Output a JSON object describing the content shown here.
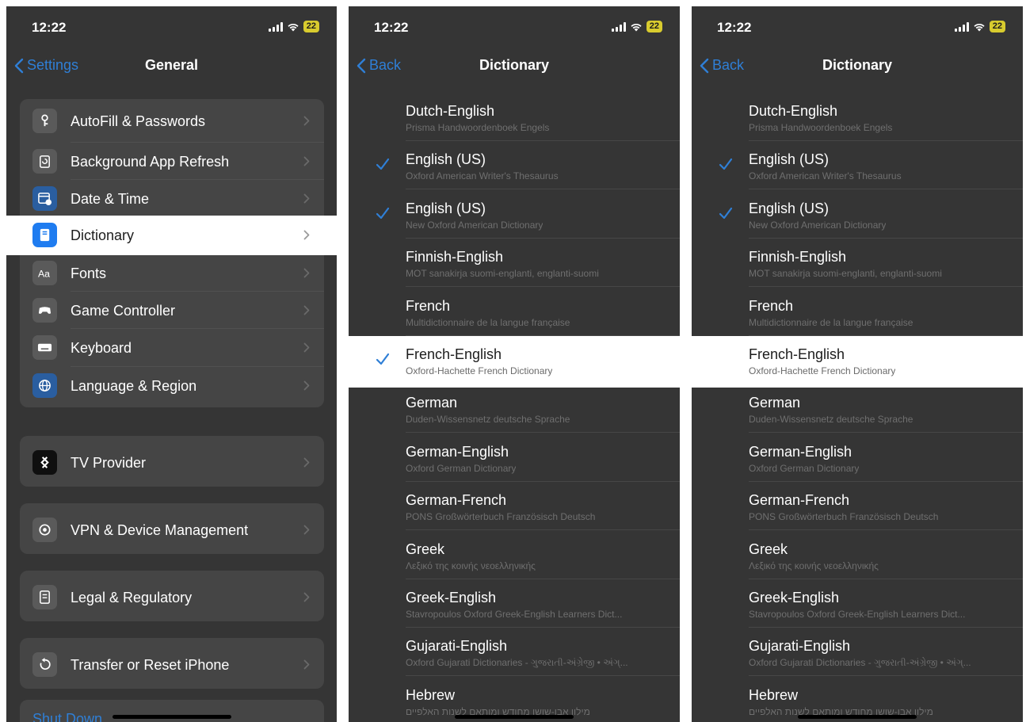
{
  "status": {
    "time": "12:22",
    "battery": "22"
  },
  "panel1": {
    "back_label": "Settings",
    "title": "General",
    "groups": [
      [
        {
          "label": "AutoFill & Passwords",
          "icon": "key-icon"
        },
        {
          "label": "Background App Refresh",
          "icon": "refresh-icon"
        },
        {
          "label": "Date & Time",
          "icon": "calendar-clock-icon"
        },
        {
          "label": "Dictionary",
          "icon": "book-icon"
        },
        {
          "label": "Fonts",
          "icon": "fonts-icon"
        },
        {
          "label": "Game Controller",
          "icon": "gamepad-icon"
        },
        {
          "label": "Keyboard",
          "icon": "keyboard-icon"
        },
        {
          "label": "Language & Region",
          "icon": "globe-icon"
        }
      ],
      [
        {
          "label": "TV Provider",
          "icon": "tv-provider-icon"
        }
      ],
      [
        {
          "label": "VPN & Device Management",
          "icon": "gear-icon"
        }
      ],
      [
        {
          "label": "Legal & Regulatory",
          "icon": "document-icon"
        }
      ],
      [
        {
          "label": "Transfer or Reset iPhone",
          "icon": "reset-icon"
        }
      ]
    ],
    "shutdown_label": "Shut Down"
  },
  "panel2": {
    "back_label": "Back",
    "title": "Dictionary"
  },
  "panel3": {
    "back_label": "Back",
    "title": "Dictionary"
  },
  "dictionaries": [
    {
      "name": "Dutch-English",
      "source": "Prisma Handwoordenboek Engels"
    },
    {
      "name": "English (US)",
      "source": "Oxford American Writer's Thesaurus"
    },
    {
      "name": "English (US)",
      "source": "New Oxford American Dictionary"
    },
    {
      "name": "Finnish-English",
      "source": "MOT sanakirja suomi-englanti, englanti-suomi"
    },
    {
      "name": "French",
      "source": "Multidictionnaire de la langue française"
    },
    {
      "name": "French-English",
      "source": "Oxford-Hachette French Dictionary"
    },
    {
      "name": "German",
      "source": "Duden-Wissensnetz deutsche Sprache"
    },
    {
      "name": "German-English",
      "source": "Oxford German Dictionary"
    },
    {
      "name": "German-French",
      "source": "PONS Großwörterbuch Französisch Deutsch"
    },
    {
      "name": "Greek",
      "source": "Λεξικό της κοινής νεοελληνικής"
    },
    {
      "name": "Greek-English",
      "source": "Stavropoulos Oxford Greek-English Learners Dict..."
    },
    {
      "name": "Gujarati-English",
      "source": "Oxford Gujarati Dictionaries - ગુજરાતી-અંગ્રેજી • અંગ્..."
    },
    {
      "name": "Hebrew",
      "source": "מילון אבן-שושן מחודש ומותאם לשנות האלפיים"
    }
  ],
  "panel2_checked": [
    1,
    2,
    5
  ],
  "panel3_checked": [
    1,
    2
  ],
  "highlighted_index": 5,
  "colors": {
    "accent": "#2f7fd6",
    "background": "#353535",
    "cell": "#454545",
    "highlight": "#ffffff"
  }
}
